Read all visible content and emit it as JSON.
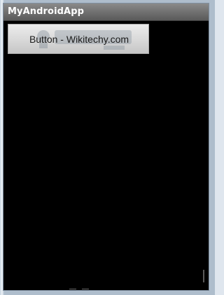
{
  "app": {
    "title": "MyAndroidApp"
  },
  "button": {
    "label": "Button - Wikitechy.com"
  },
  "colors": {
    "titlebar": "#6e6e6e",
    "screen_background": "#000000",
    "button_background": "#d8d8d8",
    "title_text": "#ffffff",
    "button_text": "#1a1a1a"
  }
}
